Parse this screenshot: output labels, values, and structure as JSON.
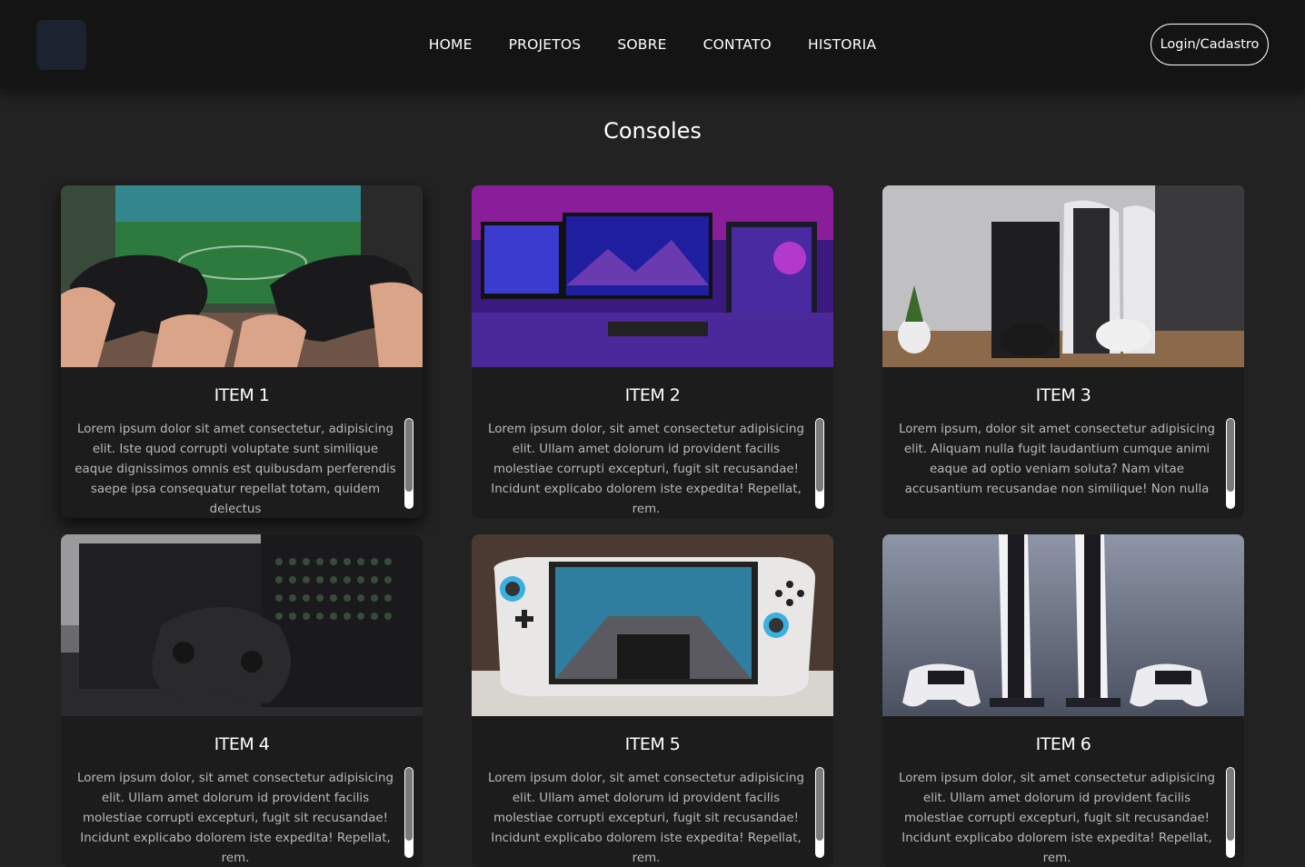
{
  "nav": {
    "items": [
      "HOME",
      "PROJETOS",
      "SOBRE",
      "CONTATO",
      "HISTORIA"
    ],
    "login_label": "Login/Cadastro"
  },
  "section": {
    "title": "Consoles"
  },
  "cards": [
    {
      "title": "ITEM 1",
      "text": "Lorem ipsum dolor sit amet consectetur, adipisicing elit. Iste quod corrupti voluptate sunt similique eaque dignissimos omnis est quibusdam perferendis saepe ipsa consequatur repellat totam, quidem delectus",
      "image_icon": "gamepads-football-photo"
    },
    {
      "title": "ITEM 2",
      "text": "Lorem ipsum dolor, sit amet consectetur adipisicing elit. Ullam amet dolorum id provident facilis molestiae corrupti excepturi, fugit sit recusandae! Incidunt explicabo dolorem iste expedita! Repellat, rem.",
      "image_icon": "gaming-setup-photo"
    },
    {
      "title": "ITEM 3",
      "text": "Lorem ipsum, dolor sit amet consectetur adipisicing elit. Aliquam nulla fugit laudantium cumque animi eaque ad optio veniam soluta? Nam vitae accusantium recusandae non similique! Non nulla",
      "image_icon": "consoles-shelf-photo"
    },
    {
      "title": "ITEM 4",
      "text": "Lorem ipsum dolor, sit amet consectetur adipisicing elit. Ullam amet dolorum id provident facilis molestiae corrupti excepturi, fugit sit recusandae! Incidunt explicabo dolorem iste expedita! Repellat, rem.",
      "image_icon": "xbox-series-x-photo"
    },
    {
      "title": "ITEM 5",
      "text": "Lorem ipsum dolor, sit amet consectetur adipisicing elit. Ullam amet dolorum id provident facilis molestiae corrupti excepturi, fugit sit recusandae! Incidunt explicabo dolorem iste expedita! Repellat, rem.",
      "image_icon": "handheld-console-photo"
    },
    {
      "title": "ITEM 6",
      "text": "Lorem ipsum dolor, sit amet consectetur adipisicing elit. Ullam amet dolorum id provident facilis molestiae corrupti excepturi, fugit sit recusandae! Incidunt explicabo dolorem iste expedita! Repellat, rem.",
      "image_icon": "ps5-consoles-photo"
    }
  ],
  "colors": {
    "background": "#222222",
    "header": "#141414",
    "card": "#1c1c1c",
    "text_muted": "#b9b9b9"
  }
}
